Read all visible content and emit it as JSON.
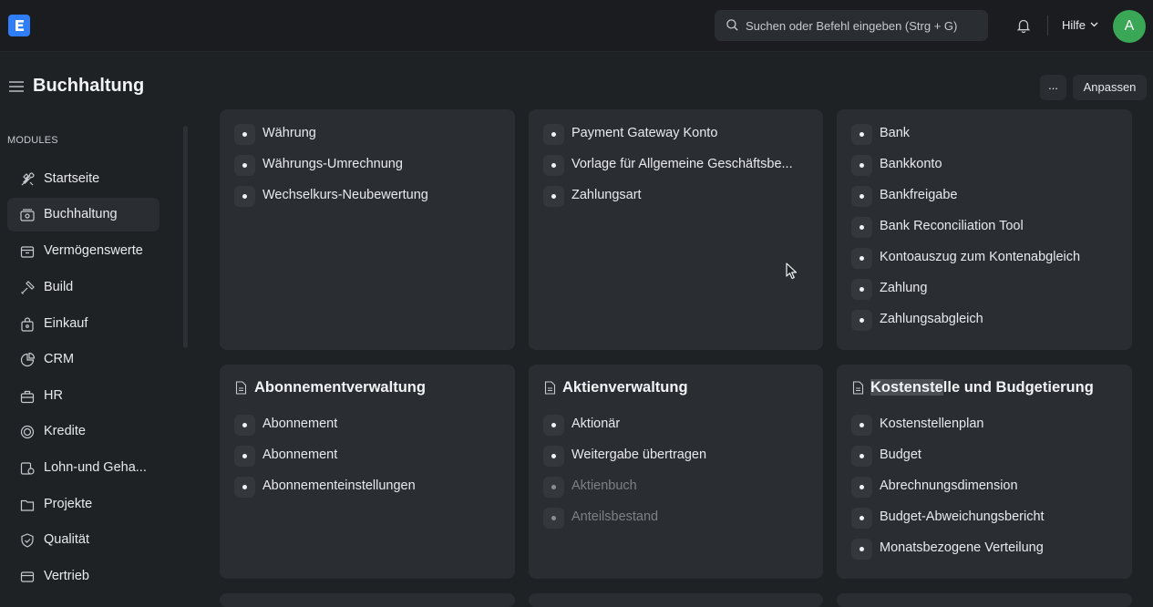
{
  "navbar": {
    "search_placeholder": "Suchen oder Befehl eingeben (Strg + G)",
    "help_label": "Hilfe",
    "avatar_initial": "A"
  },
  "header": {
    "title": "Buchhaltung",
    "more_label": "...",
    "customize_label": "Anpassen"
  },
  "sidebar": {
    "section_label": "MODULES",
    "items": [
      {
        "label": "Startseite",
        "icon": "home-tools-icon"
      },
      {
        "label": "Buchhaltung",
        "icon": "accounting-icon"
      },
      {
        "label": "Vermögenswerte",
        "icon": "assets-icon"
      },
      {
        "label": "Build",
        "icon": "build-icon"
      },
      {
        "label": "Einkauf",
        "icon": "buying-icon"
      },
      {
        "label": "CRM",
        "icon": "crm-icon"
      },
      {
        "label": "HR",
        "icon": "hr-icon"
      },
      {
        "label": "Kredite",
        "icon": "loans-icon"
      },
      {
        "label": "Lohn-und Geha...",
        "icon": "payroll-icon"
      },
      {
        "label": "Projekte",
        "icon": "projects-icon"
      },
      {
        "label": "Qualität",
        "icon": "quality-icon"
      },
      {
        "label": "Vertrieb",
        "icon": "selling-icon"
      }
    ]
  },
  "cards_top": [
    {
      "links": [
        "Währung",
        "Währungs-Umrechnung",
        "Wechselkurs-Neubewertung"
      ]
    },
    {
      "links": [
        "Payment Gateway Konto",
        "Vorlage für Allgemeine Geschäftsbe...",
        "Zahlungsart"
      ]
    },
    {
      "links": [
        "Bank",
        "Bankkonto",
        "Bankfreigabe",
        "Bank Reconciliation Tool",
        "Kontoauszug zum Kontenabgleich",
        "Zahlung",
        "Zahlungsabgleich"
      ]
    }
  ],
  "cards_bottom": [
    {
      "title": "Abonnementverwaltung",
      "links": [
        "Abonnement",
        "Abonnement",
        "Abonnementeinstellungen"
      ]
    },
    {
      "title": "Aktienverwaltung",
      "links": [
        "Aktionär",
        "Weitergabe übertragen",
        "Aktienbuch",
        "Anteilsbestand"
      ]
    },
    {
      "title_highlight": "Kostenste",
      "title_rest": "lle und Budgetierung",
      "links": [
        "Kostenstellenplan",
        "Budget",
        "Abrechnungsdimension",
        "Budget-Abweichungsbericht",
        "Monatsbezogene Verteilung"
      ]
    }
  ],
  "colors": {
    "accent": "#2f7ef7",
    "avatar": "#3aa757"
  }
}
